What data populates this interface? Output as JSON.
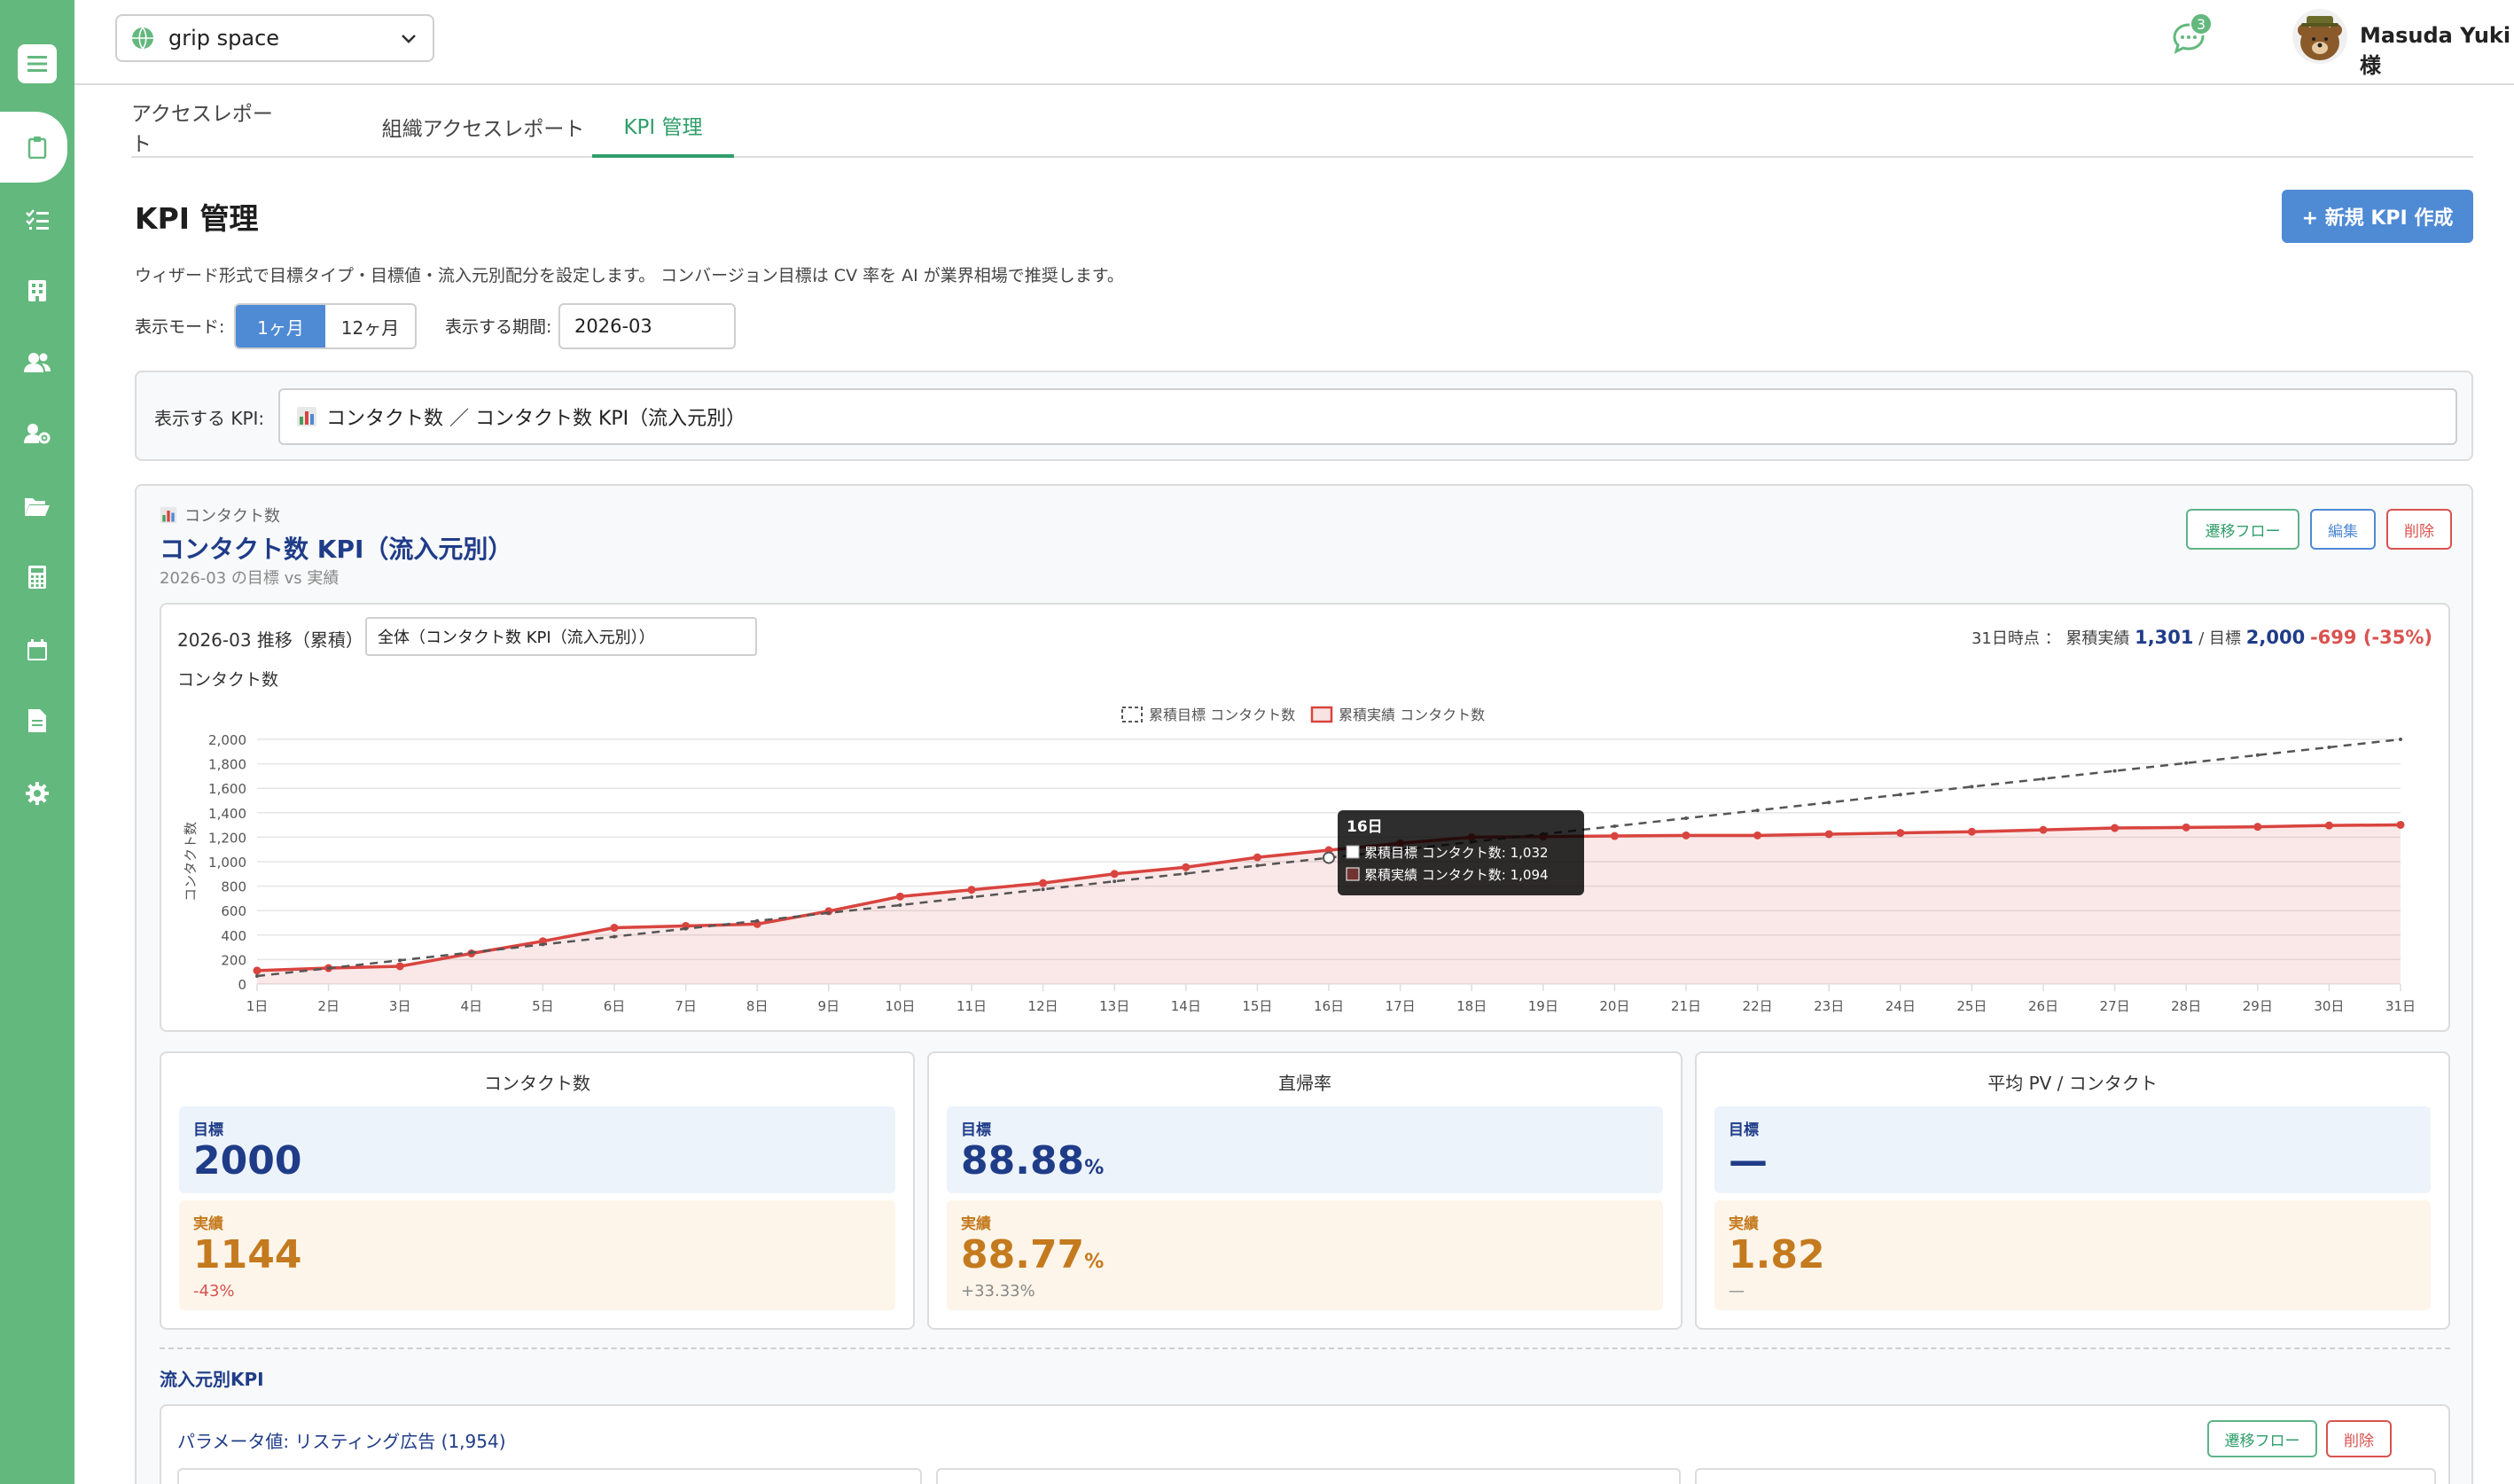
{
  "workspace": {
    "name": "grip space"
  },
  "header": {
    "username": "Masuda Yuki様",
    "chat_badge": "3"
  },
  "tabs": [
    {
      "label": "アクセスレポート",
      "active": false
    },
    {
      "label": "組織アクセスレポート",
      "active": false
    },
    {
      "label": "KPI 管理",
      "active": true
    }
  ],
  "page": {
    "title": "KPI 管理",
    "new_button": "+ 新規 KPI 作成",
    "description": "ウィザード形式で目標タイプ・目標値・流入元別配分を設定します。 コンバージョン目標は CV 率を AI が業界相場で推奨します。"
  },
  "filters": {
    "mode_label": "表示モード:",
    "mode_options": [
      "1ヶ月",
      "12ヶ月"
    ],
    "mode_selected": "1ヶ月",
    "period_label": "表示する期間:",
    "period_value": "2026-03",
    "kpi_label": "表示する KPI:",
    "kpi_value": "コンタクト数 ／ コンタクト数 KPI（流入元別）"
  },
  "kpi_card": {
    "category": "コンタクト数",
    "title": "コンタクト数 KPI（流入元別）",
    "subtitle": "2026-03 の目標 vs 実績",
    "buttons": {
      "flow": "遷移フロー",
      "edit": "編集",
      "delete": "削除"
    }
  },
  "chart_panel": {
    "title": "2026-03 推移（累積）",
    "series_select": "全体（コンタクト数 KPI（流入元別））",
    "summary_prefix": "31日時点 ： 累積実績",
    "summary_actual": "1,301",
    "summary_sep": "/ 目標",
    "summary_target": "2,000",
    "summary_diff": "-699 (-35%)",
    "unit_label": "コンタクト数"
  },
  "chart_data": {
    "type": "line",
    "ylabel": "コンタクト数",
    "ylim": [
      0,
      2000
    ],
    "yticks": [
      0,
      200,
      400,
      600,
      800,
      1000,
      1200,
      1400,
      1600,
      1800,
      2000
    ],
    "ytick_labels": [
      "0",
      "200",
      "400",
      "600",
      "800",
      "1,000",
      "1,200",
      "1,400",
      "1,600",
      "1,800",
      "2,000"
    ],
    "x": [
      "1日",
      "2日",
      "3日",
      "4日",
      "5日",
      "6日",
      "7日",
      "8日",
      "9日",
      "10日",
      "11日",
      "12日",
      "13日",
      "14日",
      "15日",
      "16日",
      "17日",
      "18日",
      "19日",
      "20日",
      "21日",
      "22日",
      "23日",
      "24日",
      "25日",
      "26日",
      "27日",
      "28日",
      "29日",
      "30日",
      "31日"
    ],
    "series": [
      {
        "name": "累積目標 コンタクト数",
        "style": "dashed",
        "color": "#555555",
        "values": [
          65,
          129,
          194,
          258,
          323,
          387,
          452,
          516,
          581,
          645,
          710,
          774,
          839,
          903,
          968,
          1032,
          1097,
          1161,
          1226,
          1290,
          1355,
          1419,
          1484,
          1548,
          1613,
          1677,
          1742,
          1806,
          1871,
          1935,
          2000
        ]
      },
      {
        "name": "累積実績 コンタクト数",
        "style": "solid",
        "color": "#d9443f",
        "values": [
          110,
          130,
          145,
          250,
          350,
          460,
          475,
          490,
          595,
          715,
          770,
          825,
          900,
          955,
          1035,
          1094,
          1150,
          1200,
          1205,
          1210,
          1215,
          1215,
          1225,
          1235,
          1245,
          1260,
          1275,
          1280,
          1285,
          1296,
          1301
        ]
      }
    ],
    "legend_position": "top",
    "grid": true,
    "tooltip": {
      "title": "16日",
      "lines": [
        "累積目標 コンタクト数: 1,032",
        "累積実績 コンタクト数: 1,094"
      ]
    }
  },
  "metrics": [
    {
      "title": "コンタクト数",
      "target_label": "目標",
      "target": "2000",
      "target_unit": "",
      "actual_label": "実績",
      "actual": "1144",
      "actual_unit": "",
      "diff": "-43%",
      "diff_red": true
    },
    {
      "title": "直帰率",
      "target_label": "目標",
      "target": "88.88",
      "target_unit": "%",
      "actual_label": "実績",
      "actual": "88.77",
      "actual_unit": "%",
      "diff": "+33.33%",
      "diff_red": false
    },
    {
      "title": "平均 PV / コンタクト",
      "target_label": "目標",
      "target": "—",
      "target_unit": "",
      "actual_label": "実績",
      "actual": "1.82",
      "actual_unit": "",
      "diff": "—",
      "diff_red": false
    }
  ],
  "inflow": {
    "section_title": "流入元別KPI",
    "card_title": "パラメータ値: リスティング広告 (1,954)",
    "flow_button": "遷移フロー",
    "delete_button": "削除"
  }
}
